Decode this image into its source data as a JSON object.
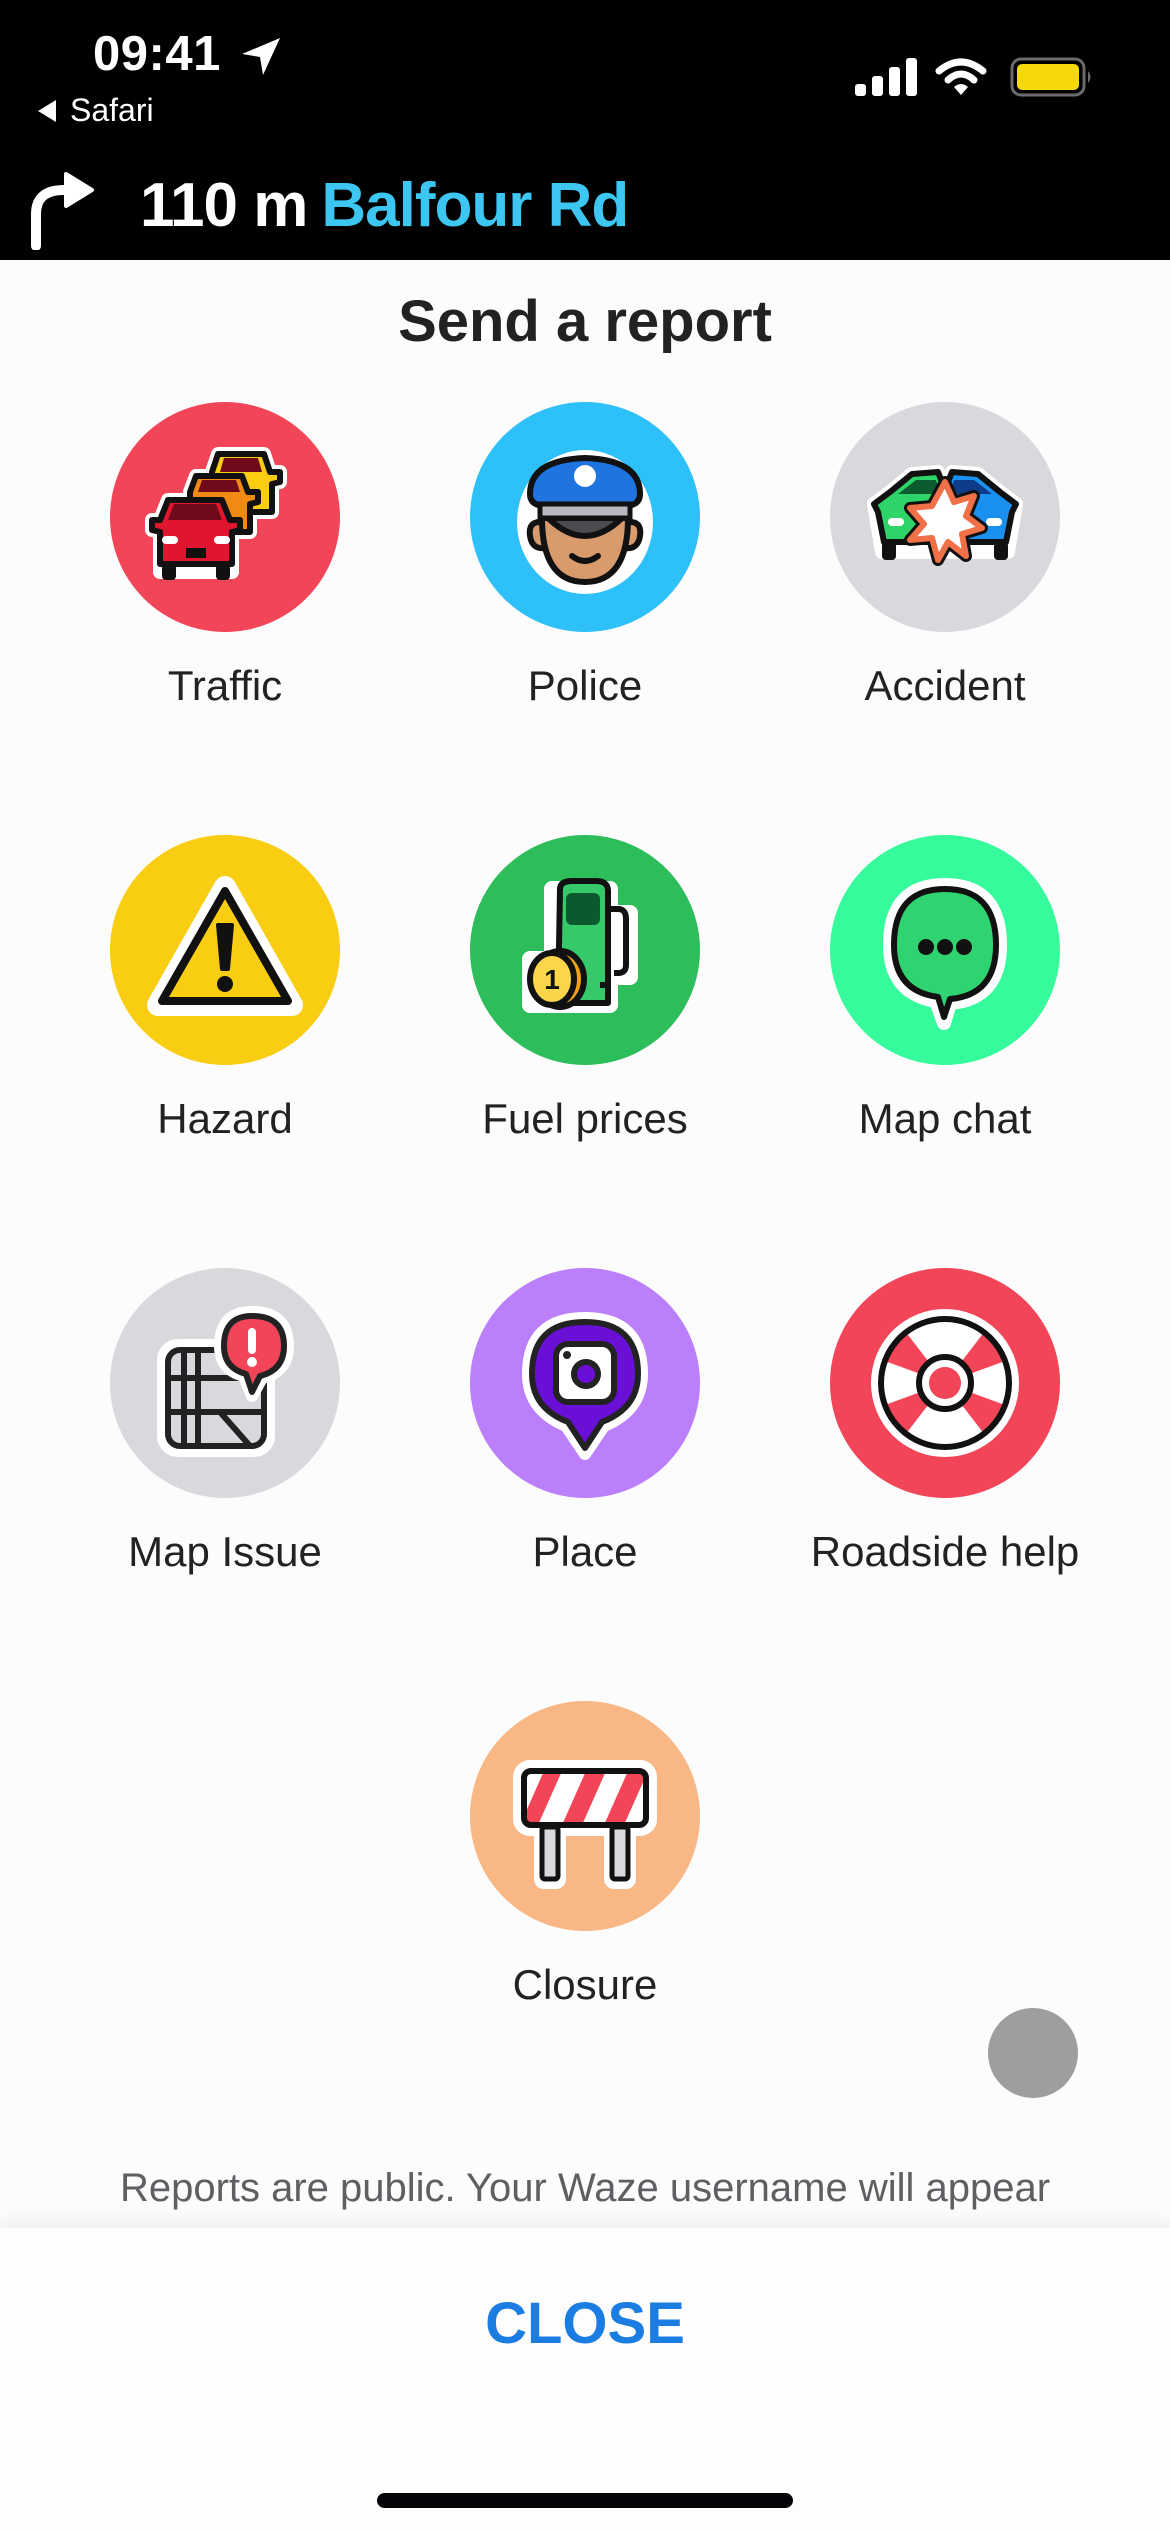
{
  "status_bar": {
    "time": "09:41",
    "back_app": "Safari",
    "battery_color": "#f5d90a",
    "icons": [
      "location-arrow-icon",
      "cellular-signal-icon",
      "wifi-icon",
      "battery-icon"
    ]
  },
  "navigation": {
    "turn_icon": "turn-right-arrow-icon",
    "distance": "110 m",
    "street": "Balfour Rd"
  },
  "sheet": {
    "title": "Send a report",
    "items": [
      {
        "label": "Traffic",
        "icon": "traffic-jam-icon",
        "color": "#f24558"
      },
      {
        "label": "Police",
        "icon": "police-officer-icon",
        "color": "#2ec0f8"
      },
      {
        "label": "Accident",
        "icon": "car-crash-icon",
        "color": "#d8d8dd"
      },
      {
        "label": "Hazard",
        "icon": "warning-triangle-icon",
        "color": "#f9cd12"
      },
      {
        "label": "Fuel prices",
        "icon": "fuel-pump-icon",
        "color": "#2dbd5a"
      },
      {
        "label": "Map chat",
        "icon": "chat-bubble-icon",
        "color": "#36fb9c"
      },
      {
        "label": "Map Issue",
        "icon": "map-issue-icon",
        "color": "#d8d8dd"
      },
      {
        "label": "Place",
        "icon": "place-camera-icon",
        "color": "#bb7ffb"
      },
      {
        "label": "Roadside help",
        "icon": "lifebuoy-icon",
        "color": "#f24558"
      },
      {
        "label": "Closure",
        "icon": "road-barrier-icon",
        "color": "#f8b785"
      }
    ],
    "notice": "Reports are public. Your Waze username will appear with your reports.",
    "close_label": "CLOSE"
  }
}
